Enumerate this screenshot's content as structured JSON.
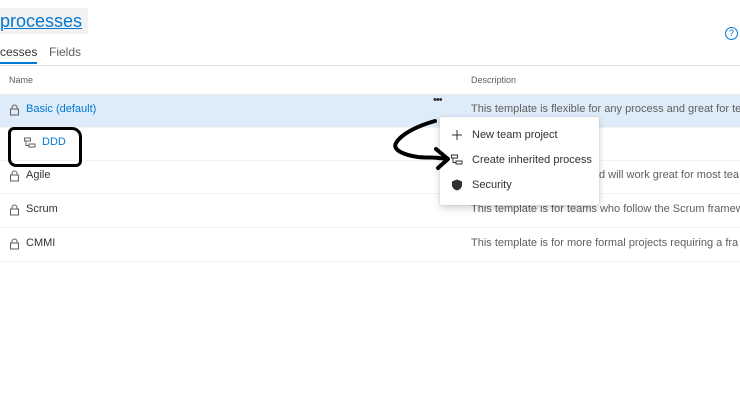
{
  "header": {
    "title": "processes",
    "help_glyph": "?"
  },
  "tabs": [
    {
      "label": "cesses",
      "active": true
    },
    {
      "label": "Fields",
      "active": false
    }
  ],
  "table": {
    "columns": {
      "name": "Name",
      "description": "Description"
    },
    "rows": [
      {
        "name": "Basic (default)",
        "description": "This template is flexible for any process and great for te",
        "selected": true
      },
      {
        "name": "DDD",
        "description": ""
      },
      {
        "name": "Agile",
        "description": "d will work great for most tea"
      },
      {
        "name": "Scrum",
        "description": "This template is for teams who follow the Scrum framew"
      },
      {
        "name": "CMMI",
        "description": "This template is for more formal projects requiring a fra"
      }
    ],
    "more_actions": "•••"
  },
  "context_menu": {
    "items": [
      {
        "label": "New team project",
        "icon": "plus-icon"
      },
      {
        "label": "Create inherited process",
        "icon": "inherit-icon"
      },
      {
        "label": "Security",
        "icon": "shield-icon"
      }
    ]
  },
  "colors": {
    "accent": "#0078d4",
    "selected_row": "#deecf9"
  }
}
